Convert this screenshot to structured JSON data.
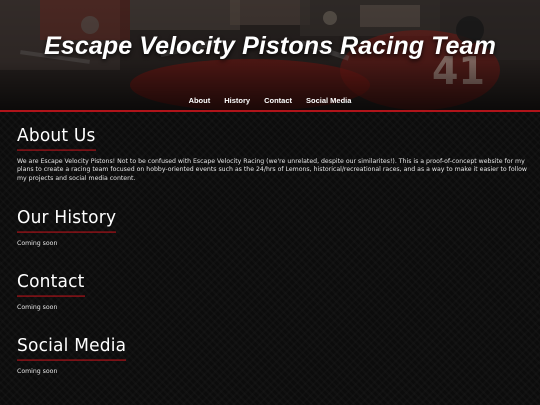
{
  "header": {
    "title": "Escape Velocity Pistons Racing Team",
    "accent_color": "#c0141c"
  },
  "nav": {
    "items": [
      {
        "label": "About"
      },
      {
        "label": "History"
      },
      {
        "label": "Contact"
      },
      {
        "label": "Social Media"
      }
    ]
  },
  "sections": {
    "about": {
      "heading": "About Us",
      "text": "We are Escape Velocity Pistons! Not to be confused with Escape Velocity Racing (we're unrelated, despite our similarites!). This is a proof-of-concept website for my plans to create a racing team focused on hobby-oriented events such as the 24/hrs of Lemons, historical/recreational races, and as a way to make it easier to follow my projects and social media content."
    },
    "history": {
      "heading": "Our History",
      "text": "Coming soon"
    },
    "contact": {
      "heading": "Contact",
      "text": "Coming soon"
    },
    "social": {
      "heading": "Social Media",
      "text": "Coming soon"
    }
  }
}
